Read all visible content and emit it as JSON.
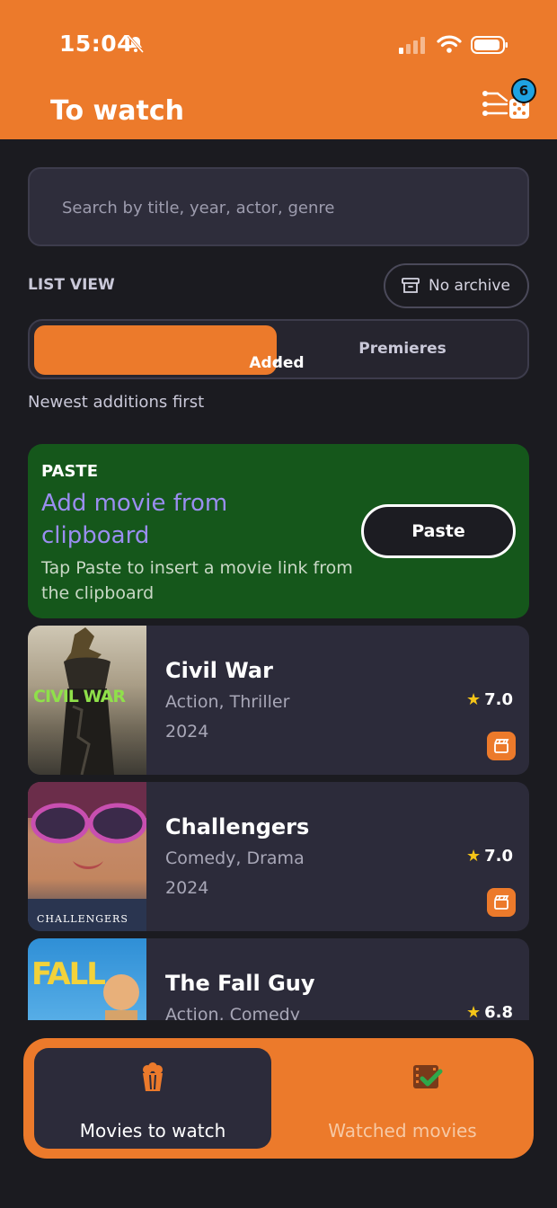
{
  "status_bar": {
    "time": "15:04"
  },
  "header": {
    "title": "To watch",
    "filter_badge_count": "6"
  },
  "search": {
    "placeholder": "Search by title, year, actor, genre"
  },
  "list_view": {
    "label": "LIST VIEW",
    "archive_button": "No archive",
    "tabs": [
      {
        "label": "Added",
        "selected": true
      },
      {
        "label": "Premieres",
        "selected": false
      }
    ],
    "sort_hint": "Newest additions first"
  },
  "paste_card": {
    "label": "PASTE",
    "title": "Add movie from clipboard",
    "description": "Tap Paste to insert a movie link from the clipboard",
    "button": "Paste"
  },
  "movies": [
    {
      "title": "Civil War",
      "genres": "Action, Thriller",
      "year": "2024",
      "rating": "7.0",
      "poster_text": "CIVIL WAR"
    },
    {
      "title": "Challengers",
      "genres": "Comedy, Drama",
      "year": "2024",
      "rating": "7.0",
      "poster_text": "CHALLENGERS"
    },
    {
      "title": "The Fall Guy",
      "genres": "Action, Comedy",
      "year": "",
      "rating": "6.8",
      "poster_text": "FALL"
    }
  ],
  "bottom_nav": {
    "items": [
      {
        "label": "Movies to watch",
        "icon": "popcorn-icon",
        "active": true
      },
      {
        "label": "Watched movies",
        "icon": "film-check-icon",
        "active": false
      }
    ]
  },
  "colors": {
    "accent": "#ec7a2b",
    "background": "#1b1b20",
    "card": "#2c2b3a",
    "paste_card": "#15571b",
    "badge": "#1fa3e2"
  }
}
